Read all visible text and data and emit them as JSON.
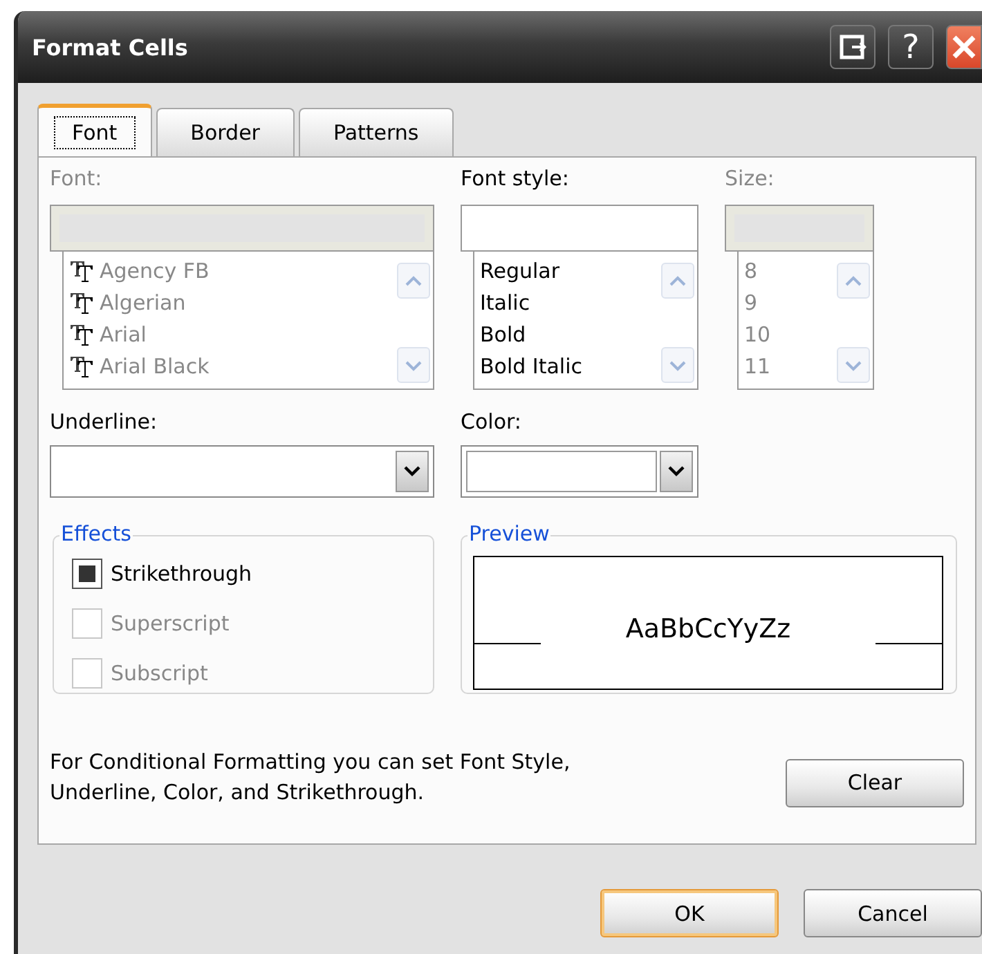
{
  "window": {
    "title": "Format Cells"
  },
  "title_buttons": [
    {
      "kind": "restore"
    },
    {
      "kind": "help",
      "label": "?"
    },
    {
      "kind": "close"
    }
  ],
  "tabs": [
    {
      "label": "Font",
      "selected": true
    },
    {
      "label": "Border",
      "selected": false
    },
    {
      "label": "Patterns",
      "selected": false
    }
  ],
  "font": {
    "label": "Font:",
    "disabled": true,
    "items": [
      "Agency FB",
      "Algerian",
      "Arial",
      "Arial Black"
    ]
  },
  "font_style": {
    "label": "Font style:",
    "disabled": false,
    "items": [
      "Regular",
      "Italic",
      "Bold",
      "Bold Italic"
    ]
  },
  "size": {
    "label": "Size:",
    "disabled": true,
    "items": [
      "8",
      "9",
      "10",
      "11"
    ]
  },
  "underline": {
    "label": "Underline:"
  },
  "color": {
    "label": "Color:"
  },
  "effects": {
    "title": "Effects",
    "options": [
      {
        "label": "Strikethrough",
        "checked": true,
        "disabled": false
      },
      {
        "label": "Superscript",
        "checked": false,
        "disabled": true
      },
      {
        "label": "Subscript",
        "checked": false,
        "disabled": true
      }
    ]
  },
  "preview": {
    "title": "Preview",
    "sample": "AaBbCcYyZz"
  },
  "note": "For Conditional Formatting you can set Font Style, Underline, Color, and Strikethrough.",
  "clear_button": {
    "label": "Clear"
  },
  "buttons": [
    {
      "label": "OK",
      "default": true
    },
    {
      "label": "Cancel",
      "default": false
    }
  ]
}
